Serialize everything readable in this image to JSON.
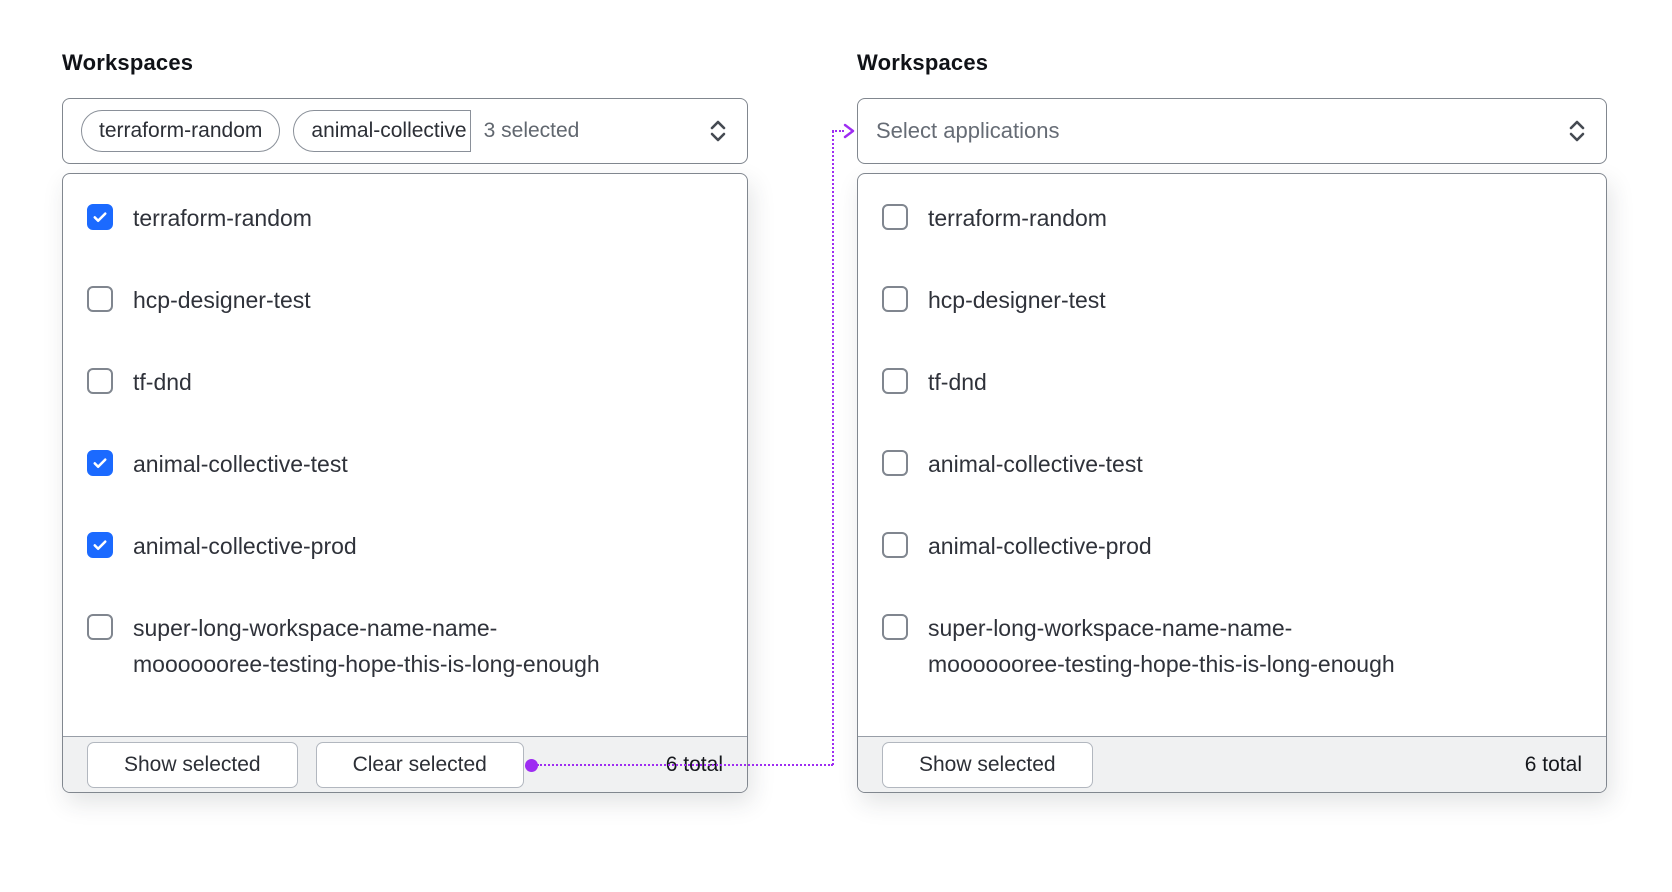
{
  "panels": {
    "left": {
      "label": "Workspaces",
      "trigger": {
        "tags": [
          "terraform-random",
          "animal-collective"
        ],
        "count_text": "3 selected"
      },
      "options": [
        {
          "label": "terraform-random",
          "checked": true
        },
        {
          "label": "hcp-designer-test",
          "checked": false
        },
        {
          "label": "tf-dnd",
          "checked": false
        },
        {
          "label": "animal-collective-test",
          "checked": true
        },
        {
          "label": "animal-collective-prod",
          "checked": true
        },
        {
          "label": "super-long-workspace-name-name-\nmooooooree-testing-hope-this-is-long-enough",
          "checked": false
        }
      ],
      "footer": {
        "show_selected_label": "Show selected",
        "clear_selected_label": "Clear selected",
        "total_text": "6 total"
      }
    },
    "right": {
      "label": "Workspaces",
      "trigger": {
        "placeholder": "Select applications"
      },
      "options": [
        {
          "label": "terraform-random",
          "checked": false
        },
        {
          "label": "hcp-designer-test",
          "checked": false
        },
        {
          "label": "tf-dnd",
          "checked": false
        },
        {
          "label": "animal-collective-test",
          "checked": false
        },
        {
          "label": "animal-collective-prod",
          "checked": false
        },
        {
          "label": "super-long-workspace-name-name-\nmooooooree-testing-hope-this-is-long-enough",
          "checked": false
        }
      ],
      "footer": {
        "show_selected_label": "Show selected",
        "total_text": "6 total"
      }
    }
  },
  "icons": {
    "trigger_chevron": "up-down-chevron",
    "checkbox_check": "checkmark",
    "connector_arrow": "right-arrowhead"
  },
  "colors": {
    "checkbox_checked": "#1b6aff",
    "connector_purple": "#9e2df2"
  }
}
